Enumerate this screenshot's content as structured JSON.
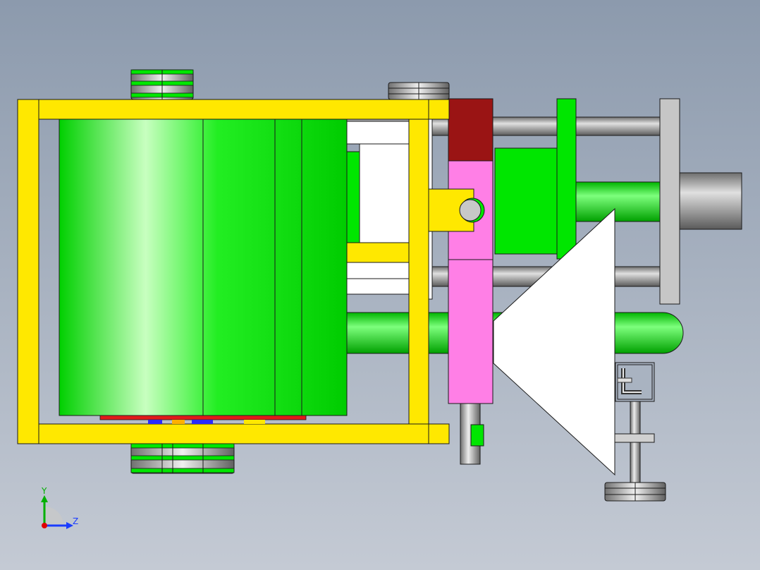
{
  "viewport": {
    "background_top": "#8c9aad",
    "background_bottom": "#c4cad4"
  },
  "colors": {
    "frame_yellow": "#ffe800",
    "drum_green": "#00e600",
    "drum_highlight": "#c8ffc0",
    "dark_red": "#9a1414",
    "pink": "#ff7fe6",
    "steel_gray": "#a8a8a8",
    "white": "#ffffff",
    "outline": "#1a1a1a"
  },
  "triad": {
    "y_label": "Y",
    "z_label": "Z",
    "y_color": "#00b000",
    "z_color": "#1a3cff",
    "x_color": "#e00000"
  }
}
